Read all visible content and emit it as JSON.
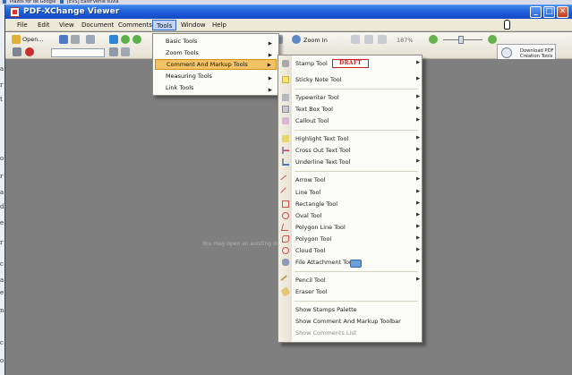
{
  "browser": {
    "bookmarks": [
      "Plazos for de Google",
      "[EVS] EastFVerile suvia"
    ]
  },
  "window": {
    "title": "PDF-XChange Viewer",
    "buttons": {
      "minimize": "_",
      "maximize": "□",
      "close": "✕"
    }
  },
  "menubar": {
    "items": [
      "File",
      "Edit",
      "View",
      "Document",
      "Comments",
      "Tools",
      "Window",
      "Help"
    ]
  },
  "toolbar": {
    "open_label": "Open...",
    "zoom_in_label": "Zoom In",
    "zoom_percent": "187%",
    "download_line1": "Download PDF",
    "download_line2": "Creation Tools"
  },
  "workspace": {
    "hint": "You may open an existing doc"
  },
  "tools_menu": {
    "items": [
      {
        "label": "Basic Tools",
        "submenu": true
      },
      {
        "label": "Zoom Tools",
        "submenu": true
      },
      {
        "label": "Comment And Markup Tools",
        "submenu": true,
        "highlighted": true
      },
      {
        "label": "Measuring Tools",
        "submenu": true
      },
      {
        "label": "Link Tools",
        "submenu": true
      }
    ]
  },
  "comment_submenu": {
    "stamp_sample": "DRAFT",
    "items": [
      {
        "label": "Stamp Tool",
        "icon": "stamp-icon",
        "submenu": true
      },
      {
        "label": "Sticky Note Tool",
        "icon": "sticky-note-icon",
        "submenu": true
      },
      {
        "label": "Typewriter Tool",
        "icon": "typewriter-icon",
        "submenu": true
      },
      {
        "label": "Text Box Tool",
        "icon": "text-box-icon",
        "submenu": true
      },
      {
        "label": "Callout Tool",
        "icon": "callout-icon",
        "submenu": true
      },
      {
        "label": "Highlight Text Tool",
        "icon": "highlight-icon",
        "submenu": true
      },
      {
        "label": "Cross Out Text Tool",
        "icon": "cross-out-icon",
        "submenu": true
      },
      {
        "label": "Underline Text Tool",
        "icon": "underline-icon",
        "submenu": true
      },
      {
        "label": "Arrow Tool",
        "icon": "arrow-tool-icon",
        "submenu": true
      },
      {
        "label": "Line Tool",
        "icon": "line-tool-icon",
        "submenu": true
      },
      {
        "label": "Rectangle Tool",
        "icon": "rectangle-icon",
        "submenu": true
      },
      {
        "label": "Oval Tool",
        "icon": "oval-icon",
        "submenu": true
      },
      {
        "label": "Polygon Line Tool",
        "icon": "polygon-line-icon",
        "submenu": true
      },
      {
        "label": "Polygon Tool",
        "icon": "polygon-icon",
        "submenu": true
      },
      {
        "label": "Cloud Tool",
        "icon": "cloud-icon",
        "submenu": true
      },
      {
        "label": "File Attachment Tool",
        "icon": "paperclip-icon",
        "submenu": true
      },
      {
        "label": "Pencil Tool",
        "icon": "pencil-icon",
        "submenu": true
      },
      {
        "label": "Eraser Tool",
        "icon": "eraser-icon",
        "submenu": false
      },
      {
        "label": "Show Stamps Palette",
        "icon": "",
        "submenu": false
      },
      {
        "label": "Show Comment And Markup Toolbar",
        "icon": "",
        "submenu": false
      },
      {
        "label": "Show Comments List",
        "icon": "",
        "submenu": false,
        "disabled": true
      }
    ]
  },
  "colors": {
    "title_bar": "#1d5ad8",
    "menu_highlight": "#f3c366",
    "workspace": "#7f7f7f",
    "draft_stamp": "#cb1d1d"
  }
}
